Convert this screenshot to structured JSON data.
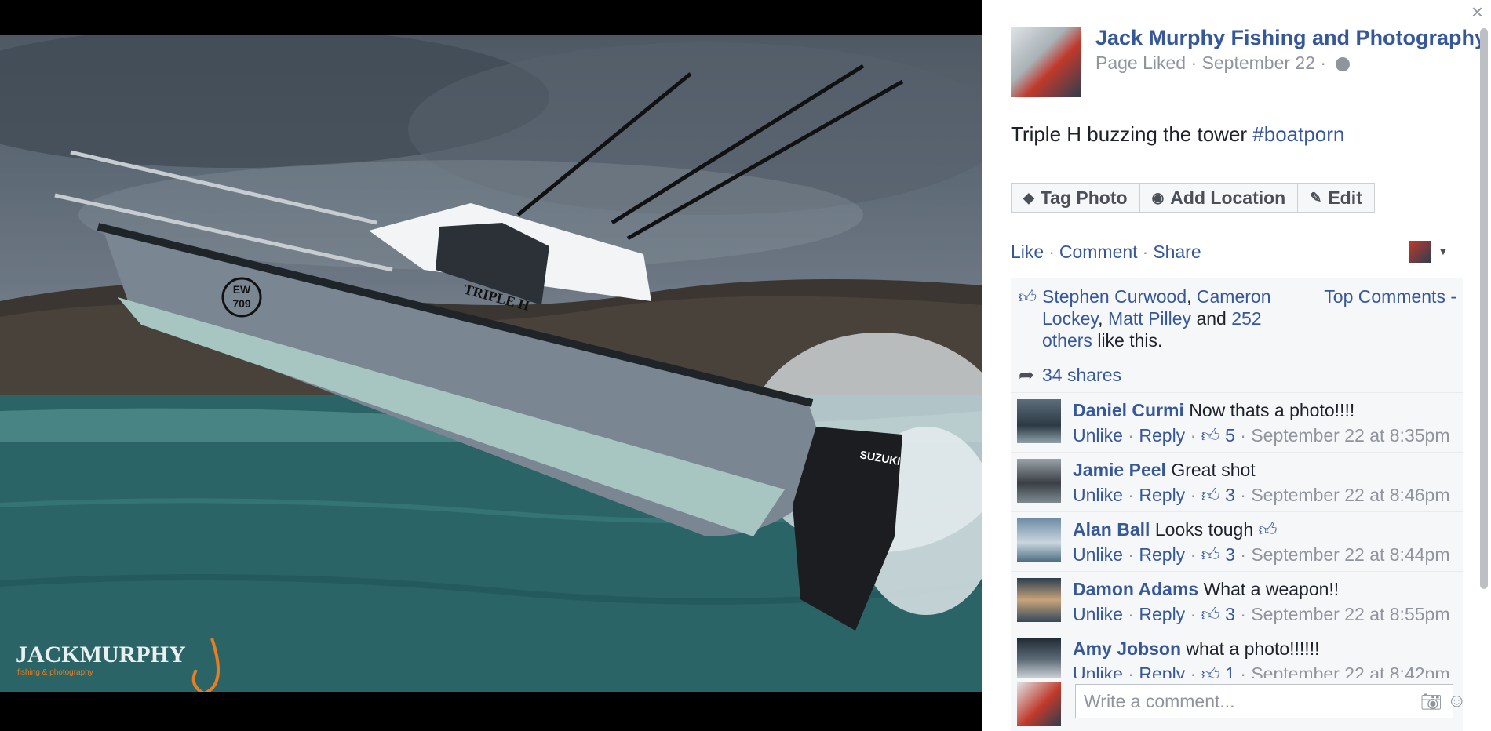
{
  "photo": {
    "watermark_main": "JACKMURPHY",
    "watermark_sub": "fishing & photography",
    "boat_name": "TRIPLE H",
    "hull_number_top": "EW",
    "hull_number_bottom": "709",
    "engine_brand": "SUZUKI"
  },
  "panel": {
    "close_icon": "close-icon",
    "author": "Jack Murphy Fishing and Photography",
    "meta": "Page Liked · September 22 ·",
    "caption_text": "Triple H buzzing the tower ",
    "caption_hashtag": "#boatporn",
    "buttons": {
      "tag_photo": "Tag Photo",
      "add_location": "Add Location",
      "edit": "Edit"
    },
    "actions": {
      "like": "Like",
      "comment": "Comment",
      "share": "Share"
    },
    "likes": {
      "name1": "Stephen Curwood",
      "name2": "Cameron Lockey",
      "name3": "Matt Pilley",
      "and": "and",
      "others": "252 others",
      "suffix": "like this."
    },
    "top_comments": "Top Comments -",
    "shares": "34 shares",
    "comments": [
      {
        "name": "Daniel Curmi",
        "text": "Now thats a photo!!!!",
        "unlike": "Unlike",
        "reply": "Reply",
        "likes": "5",
        "time": "September 22 at 8:35pm"
      },
      {
        "name": "Jamie Peel",
        "text": "Great shot",
        "unlike": "Unlike",
        "reply": "Reply",
        "likes": "3",
        "time": "September 22 at 8:46pm"
      },
      {
        "name": "Alan Ball",
        "text": "Looks tough",
        "unlike": "Unlike",
        "reply": "Reply",
        "likes": "3",
        "time": "September 22 at 8:44pm"
      },
      {
        "name": "Damon Adams",
        "text": "What a weapon!!",
        "unlike": "Unlike",
        "reply": "Reply",
        "likes": "3",
        "time": "September 22 at 8:55pm"
      },
      {
        "name": "Amy Jobson",
        "text": "what a photo!!!!!!",
        "unlike": "Unlike",
        "reply": "Reply",
        "likes": "1",
        "time": "September 22 at 8:42pm"
      }
    ],
    "composer_placeholder": "Write a comment..."
  }
}
